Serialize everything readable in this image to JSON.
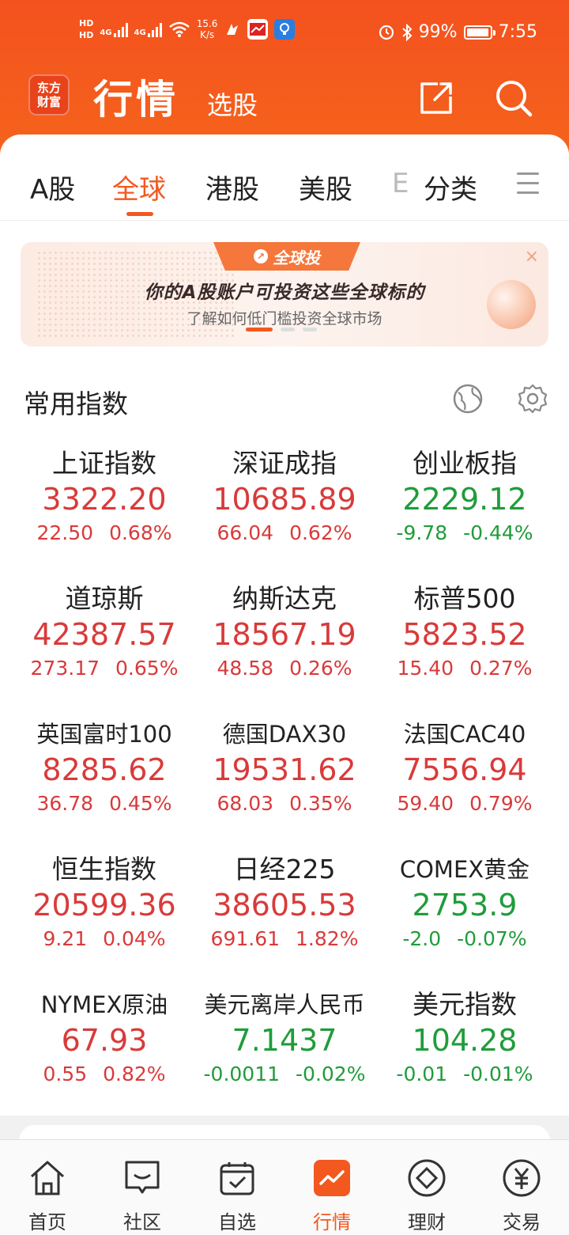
{
  "status_bar": {
    "hd1": "HD",
    "hd2": "HD",
    "sig1": "4G",
    "sig2": "4G",
    "net_speed": "15.6",
    "net_unit": "K/s",
    "battery": "99%",
    "time": "7:55"
  },
  "header": {
    "logo_line1": "东方",
    "logo_line2": "财富",
    "title": "行情",
    "subtitle": "选股"
  },
  "tabs": [
    {
      "label": "A股"
    },
    {
      "label": "全球"
    },
    {
      "label": "港股"
    },
    {
      "label": "美股"
    },
    {
      "label": "E"
    },
    {
      "label": "分类"
    }
  ],
  "banner": {
    "badge": "全球投",
    "title": "你的A股账户可投资这些全球标的",
    "subtitle": "了解如何低门槛投资全球市场",
    "close": "×"
  },
  "section": {
    "title": "常用指数"
  },
  "indices": [
    {
      "name": "上证指数",
      "price": "3322.20",
      "change": "22.50",
      "pct": "0.68%",
      "dir": "up"
    },
    {
      "name": "深证成指",
      "price": "10685.89",
      "change": "66.04",
      "pct": "0.62%",
      "dir": "up"
    },
    {
      "name": "创业板指",
      "price": "2229.12",
      "change": "-9.78",
      "pct": "-0.44%",
      "dir": "down"
    },
    {
      "name": "道琼斯",
      "price": "42387.57",
      "change": "273.17",
      "pct": "0.65%",
      "dir": "up"
    },
    {
      "name": "纳斯达克",
      "price": "18567.19",
      "change": "48.58",
      "pct": "0.26%",
      "dir": "up"
    },
    {
      "name": "标普500",
      "price": "5823.52",
      "change": "15.40",
      "pct": "0.27%",
      "dir": "up"
    },
    {
      "name": "英国富时100",
      "price": "8285.62",
      "change": "36.78",
      "pct": "0.45%",
      "dir": "up"
    },
    {
      "name": "德国DAX30",
      "price": "19531.62",
      "change": "68.03",
      "pct": "0.35%",
      "dir": "up"
    },
    {
      "name": "法国CAC40",
      "price": "7556.94",
      "change": "59.40",
      "pct": "0.79%",
      "dir": "up"
    },
    {
      "name": "恒生指数",
      "price": "20599.36",
      "change": "9.21",
      "pct": "0.04%",
      "dir": "up"
    },
    {
      "name": "日经225",
      "price": "38605.53",
      "change": "691.61",
      "pct": "1.82%",
      "dir": "up"
    },
    {
      "name": "COMEX黄金",
      "price": "2753.9",
      "change": "-2.0",
      "pct": "-0.07%",
      "dir": "down"
    },
    {
      "name": "NYMEX原油",
      "price": "67.93",
      "change": "0.55",
      "pct": "0.82%",
      "dir": "up"
    },
    {
      "name": "美元离岸人民币",
      "price": "7.1437",
      "change": "-0.0011",
      "pct": "-0.02%",
      "dir": "down"
    },
    {
      "name": "美元指数",
      "price": "104.28",
      "change": "-0.01",
      "pct": "-0.01%",
      "dir": "down"
    }
  ],
  "bottom_nav": [
    {
      "label": "首页",
      "icon": "home-icon"
    },
    {
      "label": "社区",
      "icon": "community-icon"
    },
    {
      "label": "自选",
      "icon": "watchlist-icon"
    },
    {
      "label": "行情",
      "icon": "market-icon"
    },
    {
      "label": "理财",
      "icon": "wealth-icon"
    },
    {
      "label": "交易",
      "icon": "trade-icon"
    }
  ],
  "colors": {
    "brand": "#f3581f",
    "up": "#d93a3a",
    "down": "#1f9c3a"
  }
}
